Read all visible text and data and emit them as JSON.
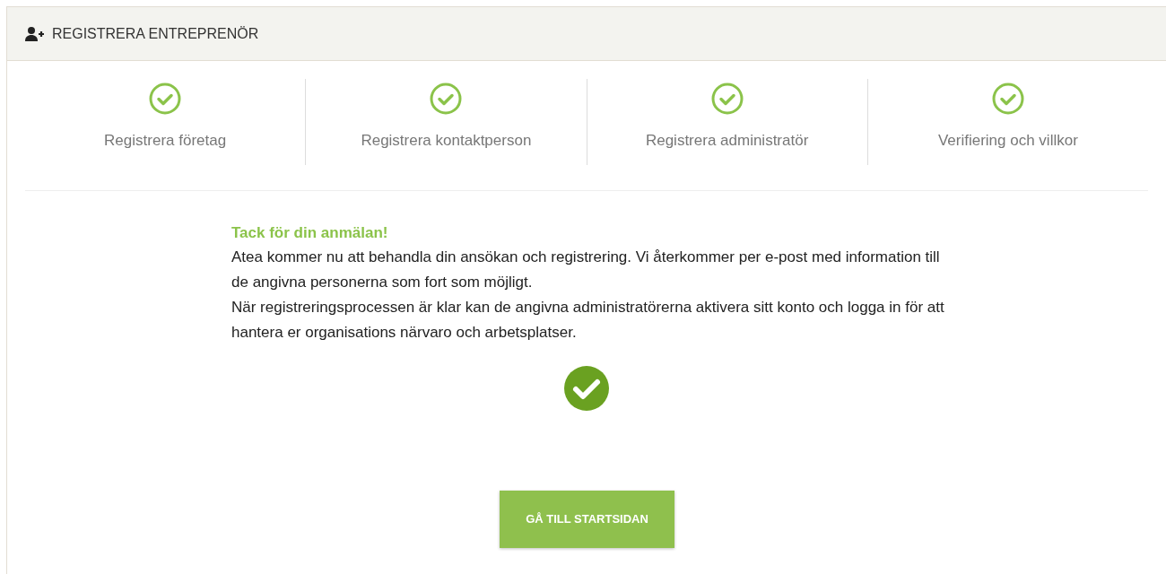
{
  "panel": {
    "title": "REGISTRERA ENTREPRENÖR"
  },
  "steps": [
    {
      "label": "Registrera företag",
      "completed": true
    },
    {
      "label": "Registrera kontaktperson",
      "completed": true
    },
    {
      "label": "Registrera administratör",
      "completed": true
    },
    {
      "label": "Verifiering och villkor",
      "completed": true
    }
  ],
  "message": {
    "heading": "Tack för din anmälan!",
    "paragraphs": [
      "Atea kommer nu att behandla din ansökan och registrering. Vi återkommer per e-post med information till de angivna personerna som fort som möjligt.",
      "När registreringsprocessen är klar kan de angivna administratörerna aktivera sitt konto och logga in för att hantera er organisations närvaro och arbetsplatser."
    ]
  },
  "button": {
    "label": "GÅ TILL STARTSIDAN"
  }
}
